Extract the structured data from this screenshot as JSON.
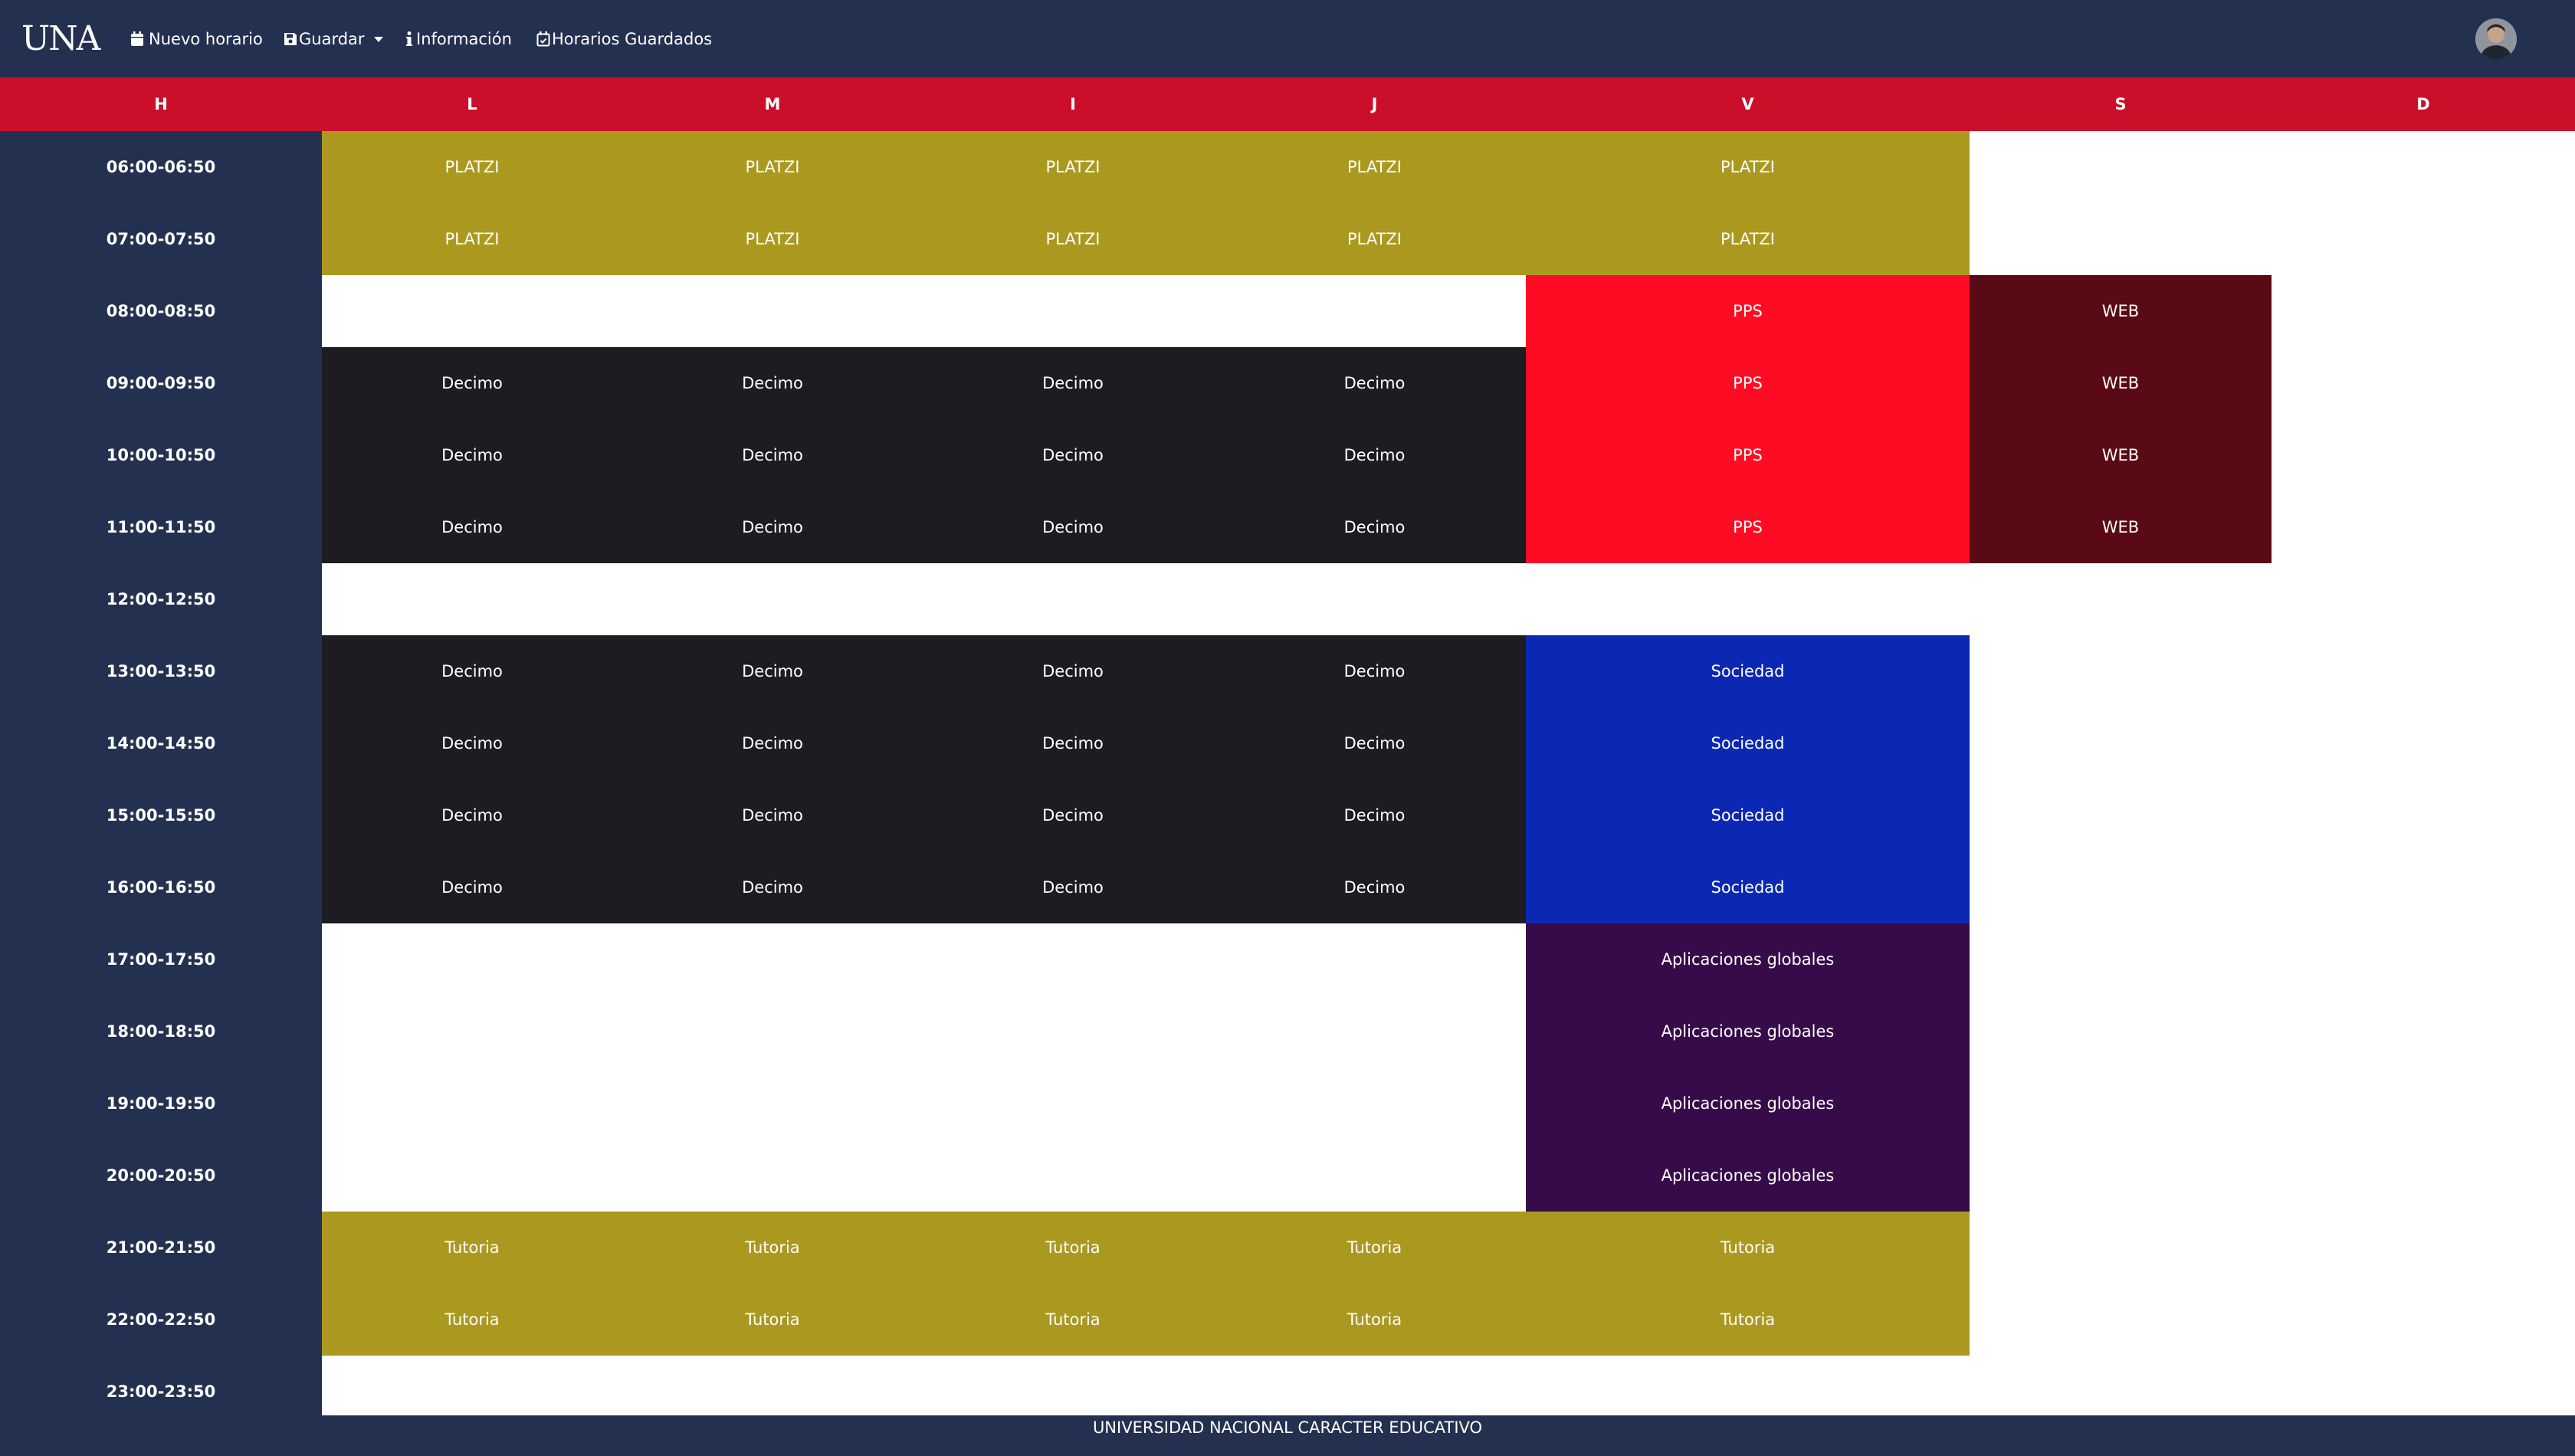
{
  "navbar": {
    "brand": "UNA",
    "items": [
      {
        "label": "Nuevo horario",
        "icon": "calendar-icon"
      },
      {
        "label": "Guardar",
        "icon": "save-icon",
        "dropdown": true
      },
      {
        "label": "Información",
        "icon": "info-icon"
      },
      {
        "label": "Horarios Guardados",
        "icon": "calendar-check-icon"
      }
    ],
    "avatar": "user-avatar"
  },
  "schedule": {
    "hour_header": "H",
    "days": [
      "L",
      "M",
      "I",
      "J",
      "V",
      "S",
      "D"
    ],
    "hours": [
      "06:00-06:50",
      "07:00-07:50",
      "08:00-08:50",
      "09:00-09:50",
      "10:00-10:50",
      "11:00-11:50",
      "12:00-12:50",
      "13:00-13:50",
      "14:00-14:50",
      "15:00-15:50",
      "16:00-16:50",
      "17:00-17:50",
      "18:00-18:50",
      "19:00-19:50",
      "20:00-20:50",
      "21:00-21:50",
      "22:00-22:50",
      "23:00-23:50"
    ],
    "subject_colors": {
      "PLATZI": "#ab991f",
      "Decimo": "#1c1c21",
      "PPS": "#ff0c24",
      "WEB": "#5a0a14",
      "Sociedad": "#0b28b4",
      "Aplicaciones globales": "#370b4a",
      "Tutoria": "#ab991f"
    },
    "rows": [
      [
        "PLATZI",
        "PLATZI",
        "PLATZI",
        "PLATZI",
        "PLATZI",
        "",
        ""
      ],
      [
        "PLATZI",
        "PLATZI",
        "PLATZI",
        "PLATZI",
        "PLATZI",
        "",
        ""
      ],
      [
        "",
        "",
        "",
        "",
        "PPS",
        "WEB",
        ""
      ],
      [
        "Decimo",
        "Decimo",
        "Decimo",
        "Decimo",
        "PPS",
        "WEB",
        ""
      ],
      [
        "Decimo",
        "Decimo",
        "Decimo",
        "Decimo",
        "PPS",
        "WEB",
        ""
      ],
      [
        "Decimo",
        "Decimo",
        "Decimo",
        "Decimo",
        "PPS",
        "WEB",
        ""
      ],
      [
        "",
        "",
        "",
        "",
        "",
        "",
        ""
      ],
      [
        "Decimo",
        "Decimo",
        "Decimo",
        "Decimo",
        "Sociedad",
        "",
        ""
      ],
      [
        "Decimo",
        "Decimo",
        "Decimo",
        "Decimo",
        "Sociedad",
        "",
        ""
      ],
      [
        "Decimo",
        "Decimo",
        "Decimo",
        "Decimo",
        "Sociedad",
        "",
        ""
      ],
      [
        "Decimo",
        "Decimo",
        "Decimo",
        "Decimo",
        "Sociedad",
        "",
        ""
      ],
      [
        "",
        "",
        "",
        "",
        "Aplicaciones globales",
        "",
        ""
      ],
      [
        "",
        "",
        "",
        "",
        "Aplicaciones globales",
        "",
        ""
      ],
      [
        "",
        "",
        "",
        "",
        "Aplicaciones globales",
        "",
        ""
      ],
      [
        "",
        "",
        "",
        "",
        "Aplicaciones globales",
        "",
        ""
      ],
      [
        "Tutoria",
        "Tutoria",
        "Tutoria",
        "Tutoria",
        "Tutoria",
        "",
        ""
      ],
      [
        "Tutoria",
        "Tutoria",
        "Tutoria",
        "Tutoria",
        "Tutoria",
        "",
        ""
      ],
      [
        "",
        "",
        "",
        "",
        "",
        "",
        ""
      ]
    ]
  },
  "footer": {
    "text": "UNIVERSIDAD NACIONAL CARACTER EDUCATIVO"
  }
}
